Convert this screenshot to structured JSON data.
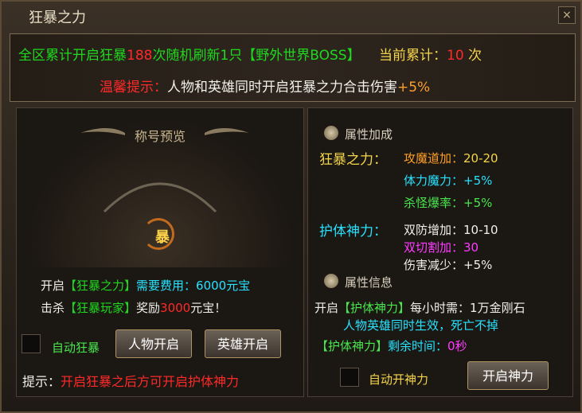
{
  "window": {
    "title": "狂暴之力",
    "close": "×"
  },
  "banner": {
    "line1": {
      "a": "全区累计开启狂暴",
      "b": "188",
      "c": "次随机刷新1只【野外世界BOSS】",
      "d": "当前累计：",
      "e": "10",
      "f": "次"
    },
    "line2": {
      "a": "温馨提示：",
      "b": "人物和英雄同时开启狂暴之力合击伤害",
      "c": "+5%"
    }
  },
  "left": {
    "preview_title": "称号预览",
    "badge_text": "暴",
    "open_row": {
      "a": "开启",
      "b": "【狂暴之力】",
      "c": "需要费用：",
      "d": "6000元宝"
    },
    "kill_row": {
      "a": "击杀",
      "b": "【狂暴玩家】",
      "c": "奖励",
      "d": "3000",
      "e": "元宝！"
    },
    "auto_label": "自动狂暴",
    "btn_person": "人物开启",
    "btn_hero": "英雄开启",
    "hint": {
      "a": "提示：",
      "b": "开启狂暴之后方可开启护体神力"
    }
  },
  "right": {
    "attr_title": "属性加成",
    "kbz_label": "狂暴之力：",
    "kbz": [
      {
        "name": "攻魔道加：",
        "value": "20-20"
      },
      {
        "name": "体力魔力：",
        "value": "+5%"
      },
      {
        "name": "杀怪爆率：",
        "value": "+5%"
      }
    ],
    "htsl_label": "护体神力：",
    "htsl": [
      {
        "name": "双防增加：",
        "value": "10-10"
      },
      {
        "name": "双切割加：",
        "value": "30"
      },
      {
        "name": "伤害减少：",
        "value": "+5%"
      }
    ],
    "info_title": "属性信息",
    "info_row1": {
      "a": "开启",
      "b": "【护体神力】",
      "c": "每小时需：1万金刚石"
    },
    "info_row2": "人物英雄同时生效，死亡不掉",
    "info_row3": {
      "a": "【护体神力】",
      "b": "剩余时间：",
      "c": "0秒"
    },
    "auto_label": "自动开神力",
    "btn_open": "开启神力"
  }
}
